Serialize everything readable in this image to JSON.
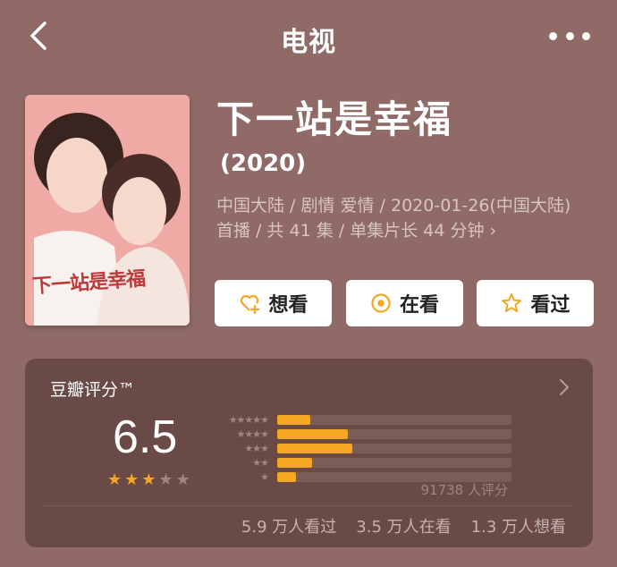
{
  "nav": {
    "title": "电视"
  },
  "show": {
    "title": "下一站是幸福",
    "year": "(2020)",
    "meta": "中国大陆 / 剧情 爱情 / 2020-01-26(中国大陆) 首播 / 共 41 集 / 单集片长 44 分钟",
    "poster_text": "下一站是幸福"
  },
  "actions": {
    "want": "想看",
    "watching": "在看",
    "watched": "看过"
  },
  "rating": {
    "title": "豆瓣评分™",
    "score": "6.5",
    "stars_filled": 3,
    "stars_total": 5,
    "distribution": [
      {
        "label": "★★★★★",
        "fraction": 0.14
      },
      {
        "label": "★★★★",
        "fraction": 0.3
      },
      {
        "label": "★★★",
        "fraction": 0.32
      },
      {
        "label": "★★",
        "fraction": 0.15
      },
      {
        "label": "★",
        "fraction": 0.08
      }
    ],
    "votes": "91738 人评分"
  },
  "counts": {
    "watched": "5.9 万人看过",
    "watching": "3.5 万人在看",
    "want": "1.3 万人想看"
  },
  "colors": {
    "background": "#8f6a66",
    "card": "#6a4a46",
    "star": "#f5a623",
    "star_empty": "#9d8683"
  },
  "icons": {
    "back": "chevron-left-icon",
    "more": "more-dots-icon",
    "want": "heart-plus-icon",
    "watching": "target-icon",
    "watched": "star-outline-icon",
    "card_arrow": "chevron-right-icon"
  }
}
